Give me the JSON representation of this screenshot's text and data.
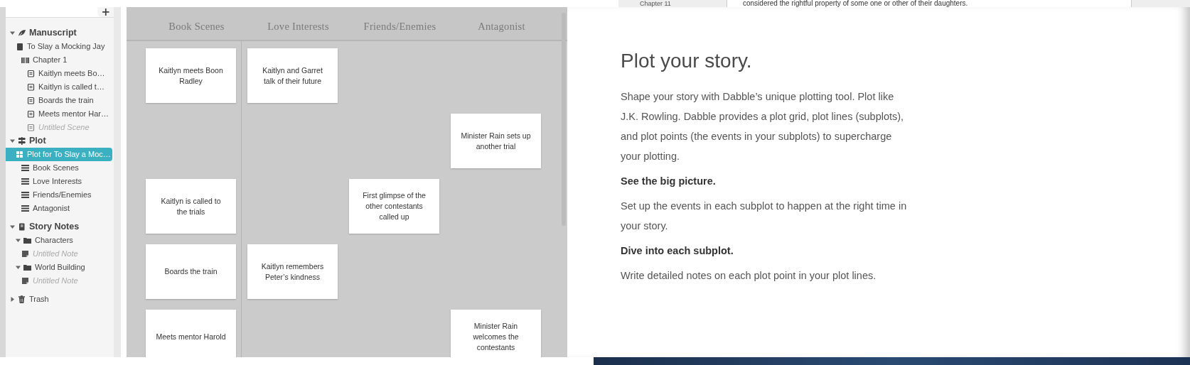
{
  "background_window": {
    "sidebar_item": "Chapter 11",
    "text": "considered the rightful property of some one or other of their daughters."
  },
  "sidebar": {
    "add_button": "+",
    "items": [
      {
        "label": "Manuscript",
        "kind": "manuscript",
        "section": true,
        "expanded": true,
        "selected": false,
        "untitled": false,
        "children": [
          {
            "label": "To Slay a Mocking Jay",
            "kind": "book",
            "section": false,
            "selected": false,
            "untitled": false,
            "children": [
              {
                "label": "Chapter 1",
                "kind": "chapter",
                "section": false,
                "selected": false,
                "untitled": false,
                "children": [
                  {
                    "label": "Kaitlyn meets Bo…",
                    "kind": "scene",
                    "section": false,
                    "selected": false,
                    "untitled": false
                  },
                  {
                    "label": "Kaitlyn is called t…",
                    "kind": "scene",
                    "section": false,
                    "selected": false,
                    "untitled": false
                  },
                  {
                    "label": "Boards the train",
                    "kind": "scene",
                    "section": false,
                    "selected": false,
                    "untitled": false
                  },
                  {
                    "label": "Meets mentor Har…",
                    "kind": "scene",
                    "section": false,
                    "selected": false,
                    "untitled": false
                  },
                  {
                    "label": "Untitled Scene",
                    "kind": "scene",
                    "section": false,
                    "selected": false,
                    "untitled": true
                  }
                ]
              }
            ]
          }
        ]
      },
      {
        "label": "Plot",
        "kind": "plot",
        "section": true,
        "expanded": true,
        "selected": false,
        "untitled": false,
        "children": [
          {
            "label": "Plot for To Slay a Moc…",
            "kind": "grid",
            "section": false,
            "selected": true,
            "untitled": false,
            "children": [
              {
                "label": "Book Scenes",
                "kind": "line",
                "section": false,
                "selected": false,
                "untitled": false
              },
              {
                "label": "Love Interests",
                "kind": "line",
                "section": false,
                "selected": false,
                "untitled": false
              },
              {
                "label": "Friends/Enemies",
                "kind": "line",
                "section": false,
                "selected": false,
                "untitled": false
              },
              {
                "label": "Antagonist",
                "kind": "line",
                "section": false,
                "selected": false,
                "untitled": false
              }
            ]
          }
        ]
      },
      {
        "label": "Story Notes",
        "kind": "notes",
        "section": true,
        "expanded": true,
        "selected": false,
        "untitled": false,
        "children": [
          {
            "label": "Characters",
            "kind": "folder",
            "section": false,
            "expanded": true,
            "selected": false,
            "untitled": false,
            "children": [
              {
                "label": "Untitled Note",
                "kind": "note",
                "section": false,
                "selected": false,
                "untitled": true
              }
            ]
          },
          {
            "label": "World Building",
            "kind": "folder",
            "section": false,
            "expanded": true,
            "selected": false,
            "untitled": false,
            "children": [
              {
                "label": "Untitled Note",
                "kind": "note",
                "section": false,
                "selected": false,
                "untitled": true
              }
            ]
          }
        ]
      },
      {
        "label": "Trash",
        "kind": "trash",
        "section": false,
        "expanded": false,
        "selected": false,
        "untitled": false
      }
    ]
  },
  "plot_grid": {
    "columns": [
      "Book Scenes",
      "Love Interests",
      "Friends/Enemies",
      "Antagonist"
    ],
    "rows": [
      {
        "cells": [
          "Kaitlyn meets Boon Radley",
          "Kaitlyn and Garret talk of their future",
          null,
          null
        ]
      },
      {
        "cells": [
          null,
          null,
          null,
          "Minister Rain sets up another trial"
        ]
      },
      {
        "cells": [
          "Kaitlyn is called to the trials",
          null,
          "First glimpse of the other contestants called up",
          null
        ]
      },
      {
        "cells": [
          "Boards the train",
          "Kaitlyn remembers Peter’s kindness",
          null,
          null
        ]
      },
      {
        "cells": [
          "Meets mentor Harold",
          null,
          null,
          "Minister Rain welcomes the contestants"
        ]
      }
    ]
  },
  "info": {
    "heading": "Plot your story.",
    "blocks": [
      {
        "kind": "paragraph",
        "text": "Shape your story with Dabble’s unique plotting tool. Plot like J.K. Rowling. Dabble provides a plot grid, plot lines (subplots), and plot points (the events in your subplots) to supercharge your plotting."
      },
      {
        "kind": "subheading",
        "text": "See the big picture."
      },
      {
        "kind": "paragraph",
        "text": "Set up the events in each subplot to happen at the right time in your story."
      },
      {
        "kind": "subheading",
        "text": "Dive into each subplot."
      },
      {
        "kind": "paragraph",
        "text": "Write detailed notes on each plot point in your plot lines."
      }
    ]
  }
}
